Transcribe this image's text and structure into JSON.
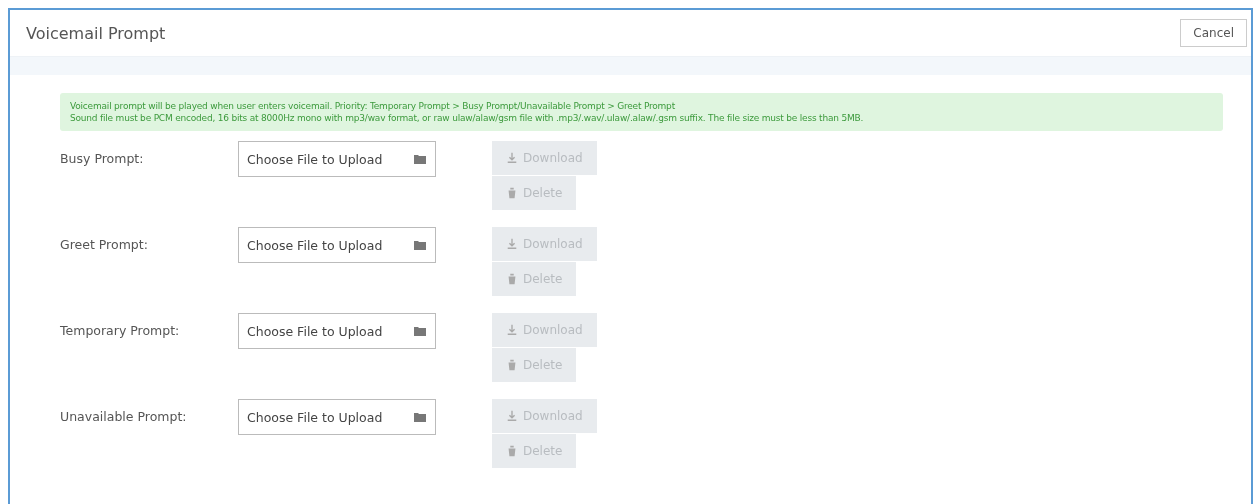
{
  "window": {
    "title": "Voicemail Prompt",
    "cancel": "Cancel"
  },
  "notice": [
    "Voicemail prompt will be played when user enters voicemail. Priority: Temporary Prompt > Busy Prompt/Unavailable Prompt > Greet Prompt",
    "Sound file must be PCM encoded, 16 bits at 8000Hz mono with mp3/wav format, or raw ulaw/alaw/gsm file with .mp3/.wav/.ulaw/.alaw/.gsm suffix. The file size must be less than 5MB."
  ],
  "prompts": [
    {
      "label": "Busy Prompt:",
      "placeholder": "Choose File to Upload",
      "download": "Download",
      "delete": "Delete",
      "disabled": true
    },
    {
      "label": "Greet Prompt:",
      "placeholder": "Choose File to Upload",
      "download": "Download",
      "delete": "Delete",
      "disabled": true
    },
    {
      "label": "Temporary Prompt:",
      "placeholder": "Choose File to Upload",
      "download": "Download",
      "delete": "Delete",
      "disabled": true
    },
    {
      "label": "Unavailable Prompt:",
      "placeholder": "Choose File to Upload",
      "download": "Download",
      "delete": "Delete",
      "disabled": true
    }
  ]
}
